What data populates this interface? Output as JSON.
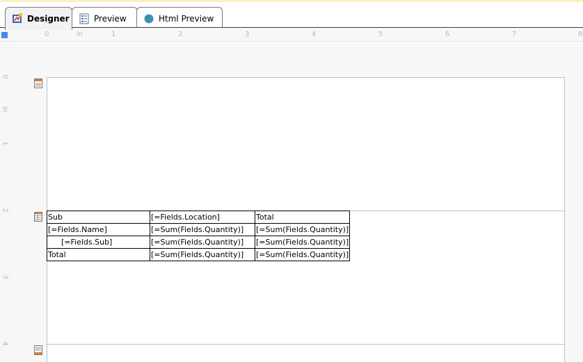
{
  "tabs": [
    {
      "label": "Designer",
      "icon": "designer-icon",
      "active": true
    },
    {
      "label": "Preview",
      "icon": "preview-icon",
      "active": false
    },
    {
      "label": "Html Preview",
      "icon": "globe-icon",
      "active": false
    }
  ],
  "ruler": {
    "unit": "in",
    "h_numbers": [
      "0",
      "1",
      "2",
      "3",
      "4",
      "5",
      "6",
      "7",
      "8"
    ],
    "v_numbers": [
      "0",
      "1",
      "2",
      "3",
      "4"
    ]
  },
  "bands": [
    {
      "name": "page-header",
      "icon": "report-header-icon"
    },
    {
      "name": "detail",
      "icon": "table-band-icon"
    },
    {
      "name": "page-footer",
      "icon": "report-footer-icon"
    }
  ],
  "table": {
    "rows": [
      [
        "Sub",
        "[=Fields.Location]",
        "Total"
      ],
      [
        "[=Fields.Name]",
        "[=Sum(Fields.Quantity)]",
        "[=Sum(Fields.Quantity)]"
      ],
      [
        "     [=Fields.Sub]",
        "[=Sum(Fields.Quantity)]",
        "[=Sum(Fields.Quantity)]"
      ],
      [
        "Total",
        "[=Sum(Fields.Quantity)]",
        "[=Sum(Fields.Quantity)]"
      ]
    ]
  },
  "colors": {
    "accent": "#4a86e8",
    "page_border": "#a9c4e0",
    "ruler_text": "#b9b9b9"
  }
}
